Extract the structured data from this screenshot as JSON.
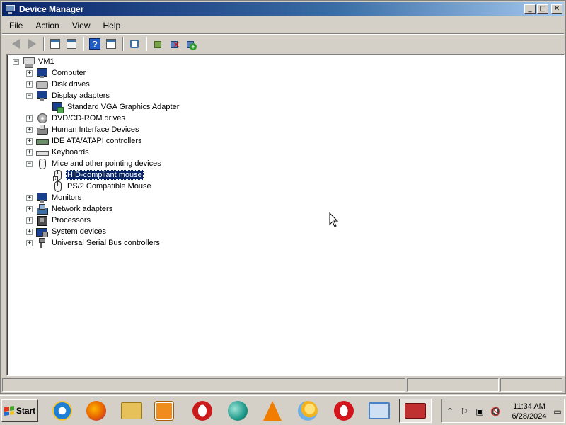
{
  "window": {
    "title": "Device Manager",
    "controls": {
      "minimize": "_",
      "maximize": "□",
      "close": "✕"
    }
  },
  "menu": [
    "File",
    "Action",
    "View",
    "Help"
  ],
  "toolbar": {
    "buttons": [
      "back-icon",
      "forward-icon",
      "console-tree-icon",
      "properties-icon",
      "help-icon",
      "show-hide-icon",
      "scan-hardware-icon",
      "update-driver-icon",
      "uninstall-icon",
      "enable-device-icon"
    ]
  },
  "tree": {
    "root": "VM1",
    "categories": [
      {
        "label": "Computer",
        "expanded": false,
        "icon": "computer-icon"
      },
      {
        "label": "Disk drives",
        "expanded": false,
        "icon": "disk-icon"
      },
      {
        "label": "Display adapters",
        "expanded": true,
        "icon": "display-adapter-icon",
        "children": [
          {
            "label": "Standard VGA Graphics Adapter",
            "icon": "vga-adapter-icon"
          }
        ]
      },
      {
        "label": "DVD/CD-ROM drives",
        "expanded": false,
        "icon": "cdrom-icon"
      },
      {
        "label": "Human Interface Devices",
        "expanded": false,
        "icon": "hid-icon"
      },
      {
        "label": "IDE ATA/ATAPI controllers",
        "expanded": false,
        "icon": "ide-controller-icon"
      },
      {
        "label": "Keyboards",
        "expanded": false,
        "icon": "keyboard-icon"
      },
      {
        "label": "Mice and other pointing devices",
        "expanded": true,
        "icon": "mouse-icon",
        "children": [
          {
            "label": "HID-compliant mouse",
            "icon": "mouse-disabled-icon",
            "selected": true
          },
          {
            "label": "PS/2 Compatible Mouse",
            "icon": "mouse-icon"
          }
        ]
      },
      {
        "label": "Monitors",
        "expanded": false,
        "icon": "monitor-icon"
      },
      {
        "label": "Network adapters",
        "expanded": false,
        "icon": "network-adapter-icon"
      },
      {
        "label": "Processors",
        "expanded": false,
        "icon": "processor-icon"
      },
      {
        "label": "System devices",
        "expanded": false,
        "icon": "system-devices-icon"
      },
      {
        "label": "Universal Serial Bus controllers",
        "expanded": false,
        "icon": "usb-icon"
      }
    ]
  },
  "taskbar": {
    "start_label": "Start",
    "apps": [
      {
        "name": "internet-explorer-icon",
        "color": "#1e7fd6"
      },
      {
        "name": "firefox-icon",
        "color": "#e66000"
      },
      {
        "name": "file-explorer-icon",
        "color": "#e6c15a"
      },
      {
        "name": "media-player-icon",
        "color": "#f08c1e"
      },
      {
        "name": "opera-icon",
        "color": "#cc1b1b"
      },
      {
        "name": "browser-icon",
        "color": "#1f9a8a"
      },
      {
        "name": "vlc-icon",
        "color": "#f07d00"
      },
      {
        "name": "weather-icon",
        "color": "#f5b21a"
      },
      {
        "name": "opera-red-icon",
        "color": "#d4141b"
      },
      {
        "name": "control-panel-icon",
        "color": "#4a82c9"
      },
      {
        "name": "device-manager-task-icon",
        "color": "#c13030",
        "active": true
      }
    ],
    "tray": {
      "time": "11:34 AM",
      "date": "6/28/2024"
    }
  },
  "colors": {
    "selection": "#0a246a",
    "titlebar_start": "#0a246a",
    "face": "#d4d0c8"
  }
}
